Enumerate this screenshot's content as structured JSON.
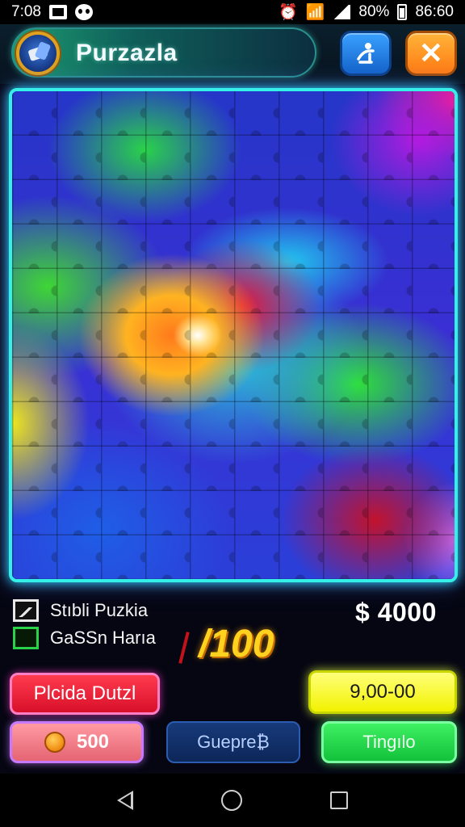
{
  "status_bar": {
    "time": "7:08",
    "battery": "80%",
    "clock_right": "86:60",
    "icons": [
      "gallery-icon",
      "face-icon",
      "alarm-icon",
      "wifi-icon",
      "signal-icon",
      "battery-icon"
    ]
  },
  "header": {
    "title": "Purzazla",
    "logo_icon": "game-logo-icon",
    "share_icon": "share-icon",
    "close_icon": "close-icon",
    "close_glyph": "✕"
  },
  "board": {
    "image_icon": "jigsaw-puzzle-board"
  },
  "info": {
    "line1": "Stıbli Puzkia",
    "line2": "GaSSn Harıa",
    "price": "$ 4000",
    "counter": "/100"
  },
  "buttons": {
    "red_label": "Plcida Dutzl",
    "yellow_label": "9,00-00",
    "coins_value": "500",
    "blue_label": "Guepre₿",
    "green_label": "Tingılo"
  },
  "colors": {
    "accent_cyan": "#35f0e6",
    "red": "#d8102a",
    "yellow": "#f2f200",
    "green": "#12c23a",
    "blue": "#0d2658",
    "orange": "#ff7a12"
  }
}
